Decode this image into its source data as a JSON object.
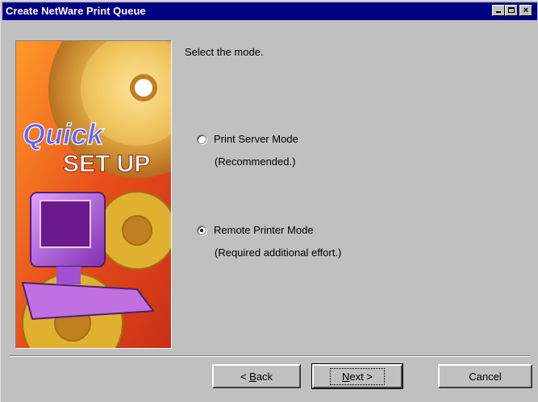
{
  "window": {
    "title": "Create NetWare Print Queue",
    "controls": {
      "minimize": "minimize",
      "maximize": "maximize",
      "close": "×"
    }
  },
  "banner": {
    "line1": "Quick",
    "line2": "SET UP"
  },
  "main": {
    "prompt": "Select the mode.",
    "options": [
      {
        "label": "Print Server Mode",
        "note": "(Recommended.)",
        "selected": false
      },
      {
        "label": "Remote Printer Mode",
        "note": "(Required additional effort.)",
        "selected": true
      }
    ]
  },
  "buttons": {
    "back_arrow": "<",
    "back_mnemonic": "B",
    "back_rest": "ack",
    "next_mnemonic": "N",
    "next_rest": "ext",
    "next_arrow": ">",
    "cancel": "Cancel"
  },
  "colors": {
    "titlebar": "#000080",
    "face": "#c0c0c0"
  }
}
